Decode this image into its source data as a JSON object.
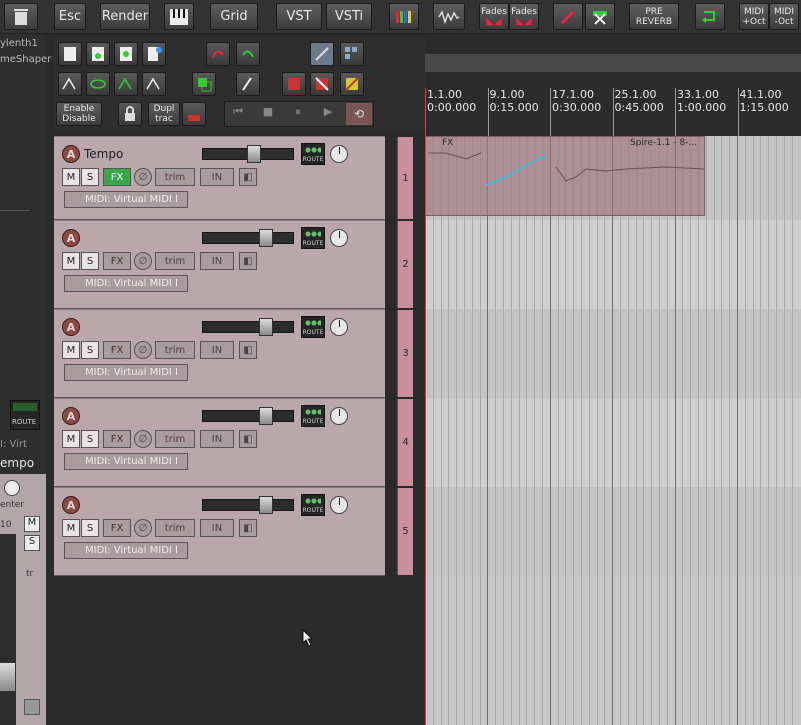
{
  "toolbar": {
    "esc": "Esc",
    "render": "Render",
    "grid": "Grid",
    "vst": "VST",
    "vsti": "VSTi",
    "fades1": "Fades",
    "fades2": "Fades",
    "pre_reverb_1": "PRE",
    "pre_reverb_2": "REVERB",
    "midi_up": "MIDI",
    "midi_up_sub": "+Oct",
    "midi_down": "MIDI",
    "midi_down_sub": "-Oct"
  },
  "left_strip": {
    "label1": "ylenth1",
    "label2": "meShaper",
    "route": "ROUTE",
    "midi": "I: Virt",
    "tempo": "empo",
    "center": "enter",
    "m": "M",
    "s": "S",
    "tr": "tr",
    "db10": "10"
  },
  "secondary": {
    "enable_disable_1": "Enable",
    "enable_disable_2": "Disable",
    "dupl_1": "Dupl",
    "dupl_2": "trac"
  },
  "tracks": [
    {
      "number": "1",
      "name": "Tempo",
      "m": "M",
      "s": "S",
      "fx": "FX",
      "trim": "trim",
      "input": "IN",
      "midi": "MIDI: Virtual MIDI I",
      "route": "ROUTE",
      "fx_active": true
    },
    {
      "number": "2",
      "name": "",
      "m": "M",
      "s": "S",
      "fx": "FX",
      "trim": "trim",
      "input": "IN",
      "midi": "MIDI: Virtual MIDI I",
      "route": "ROUTE",
      "fx_active": false
    },
    {
      "number": "3",
      "name": "",
      "m": "M",
      "s": "S",
      "fx": "FX",
      "trim": "trim",
      "input": "IN",
      "midi": "MIDI: Virtual MIDI I",
      "route": "ROUTE",
      "fx_active": false
    },
    {
      "number": "4",
      "name": "",
      "m": "M",
      "s": "S",
      "fx": "FX",
      "trim": "trim",
      "input": "IN",
      "midi": "MIDI: Virtual MIDI I",
      "route": "ROUTE",
      "fx_active": false
    },
    {
      "number": "5",
      "name": "",
      "m": "M",
      "s": "S",
      "fx": "FX",
      "trim": "trim",
      "input": "IN",
      "midi": "MIDI: Virtual MIDI I",
      "route": "ROUTE",
      "fx_active": false
    }
  ],
  "ruler": {
    "bars": [
      {
        "bar": "1.1.00",
        "time": "0:00.000"
      },
      {
        "bar": "9.1.00",
        "time": "0:15.000"
      },
      {
        "bar": "17.1.00",
        "time": "0:30.000"
      },
      {
        "bar": "25.1.00",
        "time": "0:45.000"
      },
      {
        "bar": "33.1.00",
        "time": "1:00.000"
      },
      {
        "bar": "41.1.00",
        "time": "1:15.000"
      }
    ]
  },
  "items": {
    "spire_label": "Spire-1.1 - 8-...",
    "fx_tag": "FX"
  },
  "colors": {
    "track_bg": "#b9a7ab",
    "track_number_bg": "#c9909b",
    "fx_active": "#3aa84a",
    "arrange_bg": "#c7c7c7"
  }
}
